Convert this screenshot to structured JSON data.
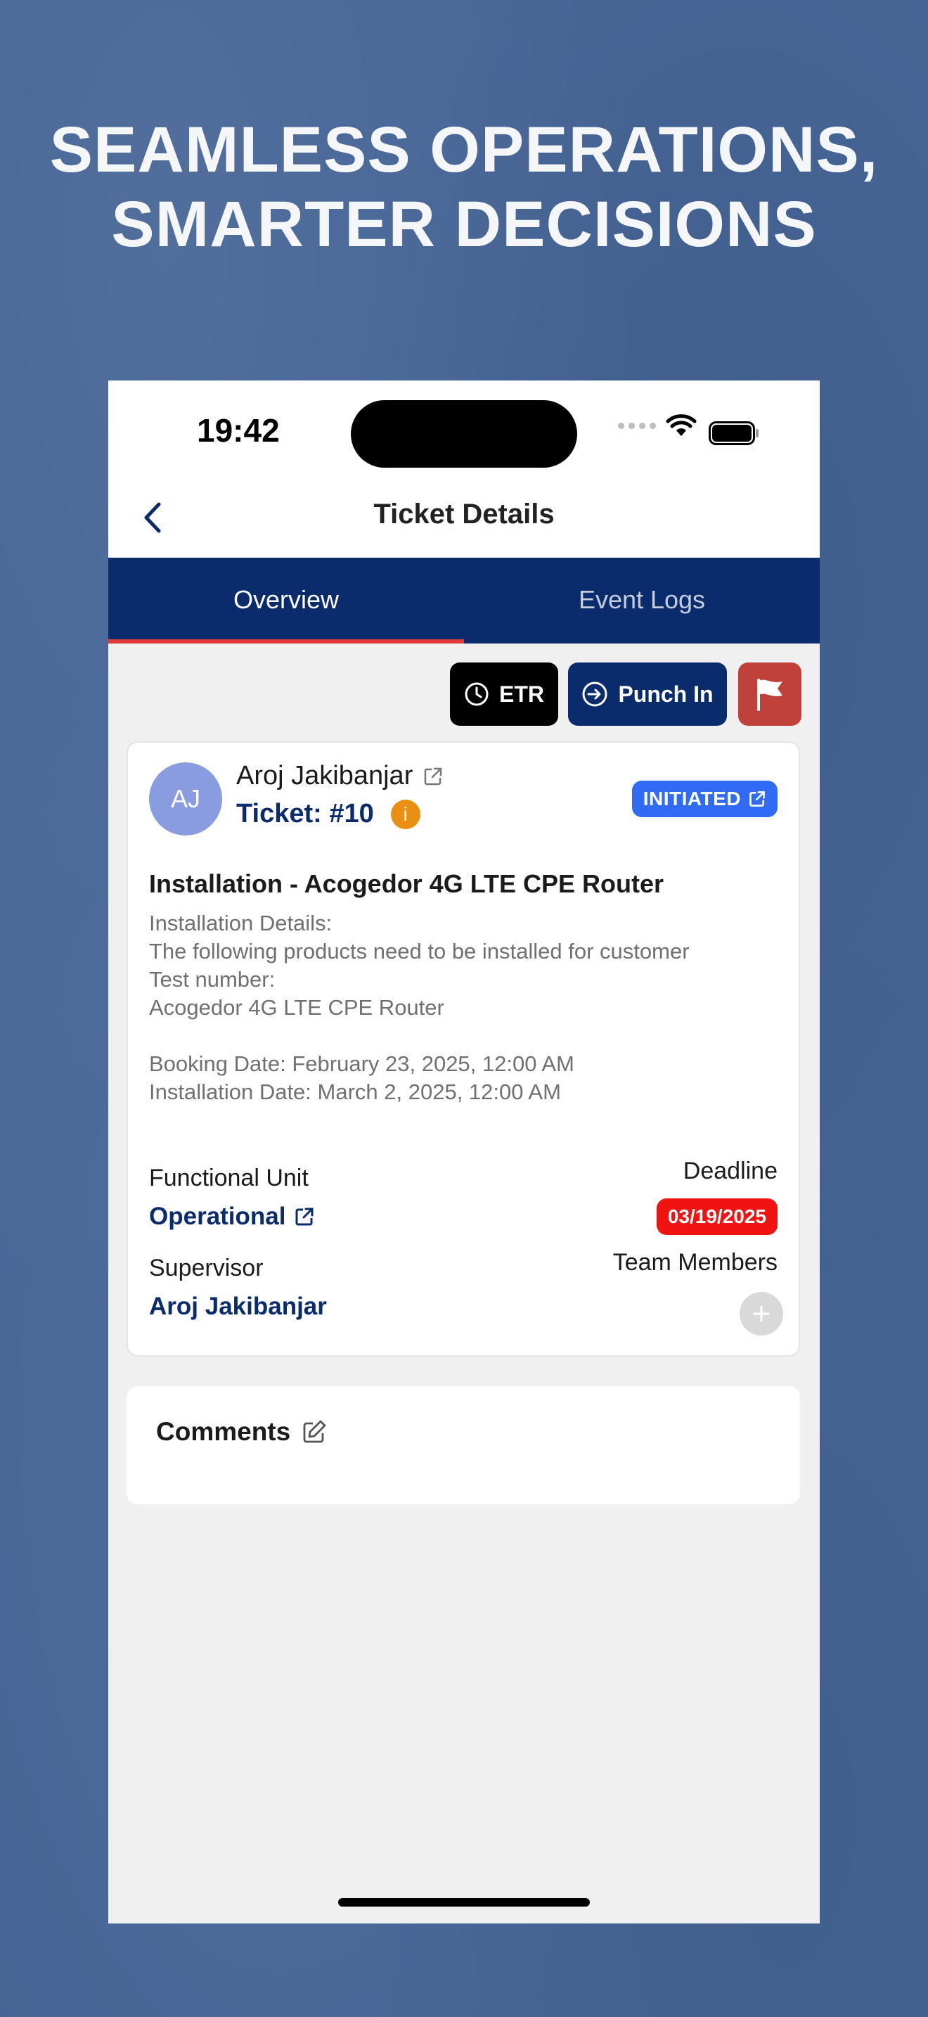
{
  "headline": {
    "line1": "SEAMLESS OPERATIONS,",
    "line2": "SMARTER DECISIONS"
  },
  "status_bar": {
    "time": "19:42"
  },
  "nav": {
    "title": "Ticket Details",
    "back_icon": "chevron-left-icon"
  },
  "tabs": [
    {
      "label": "Overview",
      "active": true
    },
    {
      "label": "Event Logs",
      "active": false
    }
  ],
  "actions": {
    "etr_label": "ETR",
    "punch_in_label": "Punch In",
    "flag_icon": "flag-icon"
  },
  "ticket": {
    "avatar_initials": "AJ",
    "assignee": "Aroj Jakibanjar",
    "ticket_label": "Ticket: #10",
    "info_badge": "i",
    "status": "INITIATED",
    "title": "Installation - Acogedor 4G LTE CPE Router",
    "description_lines": [
      "Installation Details:",
      "The following products need to be installed for customer",
      "Test number:",
      "Acogedor 4G LTE CPE Router"
    ],
    "date_lines": [
      "Booking Date: February 23, 2025, 12:00 AM",
      "Installation Date: March 2, 2025, 12:00 AM"
    ],
    "functional_unit_label": "Functional Unit",
    "functional_unit_value": "Operational",
    "deadline_label": "Deadline",
    "deadline_value": "03/19/2025",
    "supervisor_label": "Supervisor",
    "supervisor_value": "Aroj Jakibanjar",
    "team_members_label": "Team Members"
  },
  "comments": {
    "title": "Comments"
  },
  "colors": {
    "background": "#466596",
    "navy": "#0A2C6C",
    "tab_indicator": "#E03B3B",
    "status_blue": "#2F6BF5",
    "deadline_red": "#F11212",
    "flag_button": "#C0403A",
    "info_orange": "#E98F12"
  }
}
